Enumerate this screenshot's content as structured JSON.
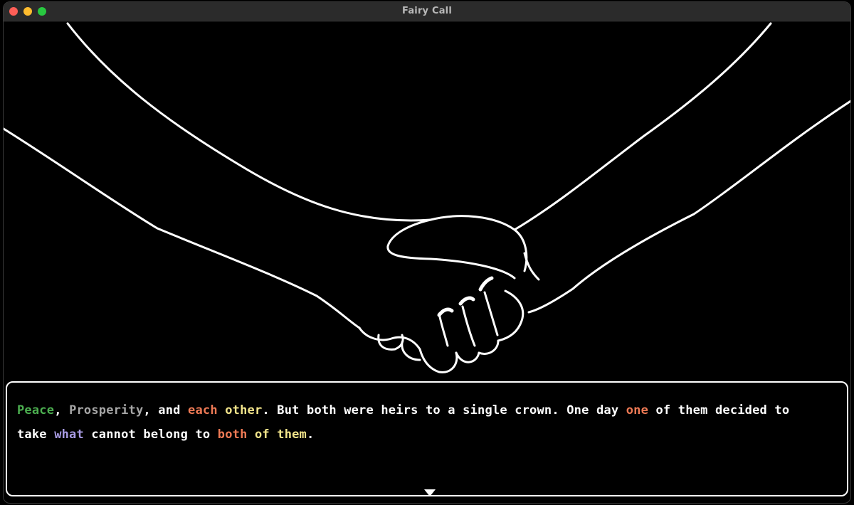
{
  "window": {
    "title": "Fairy Call"
  },
  "dialog": {
    "segments": [
      {
        "text": "Peace",
        "color": "green"
      },
      {
        "text": ", ",
        "color": "white"
      },
      {
        "text": "Prosperity",
        "color": "gray"
      },
      {
        "text": ", and ",
        "color": "white"
      },
      {
        "text": "each",
        "color": "orange"
      },
      {
        "text": " ",
        "color": "white"
      },
      {
        "text": "other",
        "color": "yellow"
      },
      {
        "text": ". But both were heirs to a single crown. One day ",
        "color": "white"
      },
      {
        "text": "one",
        "color": "orange"
      },
      {
        "text": " of them decided to take ",
        "color": "white"
      },
      {
        "text": "what",
        "color": "purple"
      },
      {
        "text": " cannot belong to ",
        "color": "white"
      },
      {
        "text": "both",
        "color": "orange"
      },
      {
        "text": " ",
        "color": "white"
      },
      {
        "text": "of them",
        "color": "yellow"
      },
      {
        "text": ".",
        "color": "white"
      }
    ]
  },
  "colors": {
    "green": "#4caf50",
    "gray": "#a6a6a6",
    "orange": "#ef7a55",
    "yellow": "#f3e58b",
    "purple": "#a89be3",
    "white": "#ffffff"
  },
  "icons": {
    "advance": "triangle-down-icon"
  }
}
